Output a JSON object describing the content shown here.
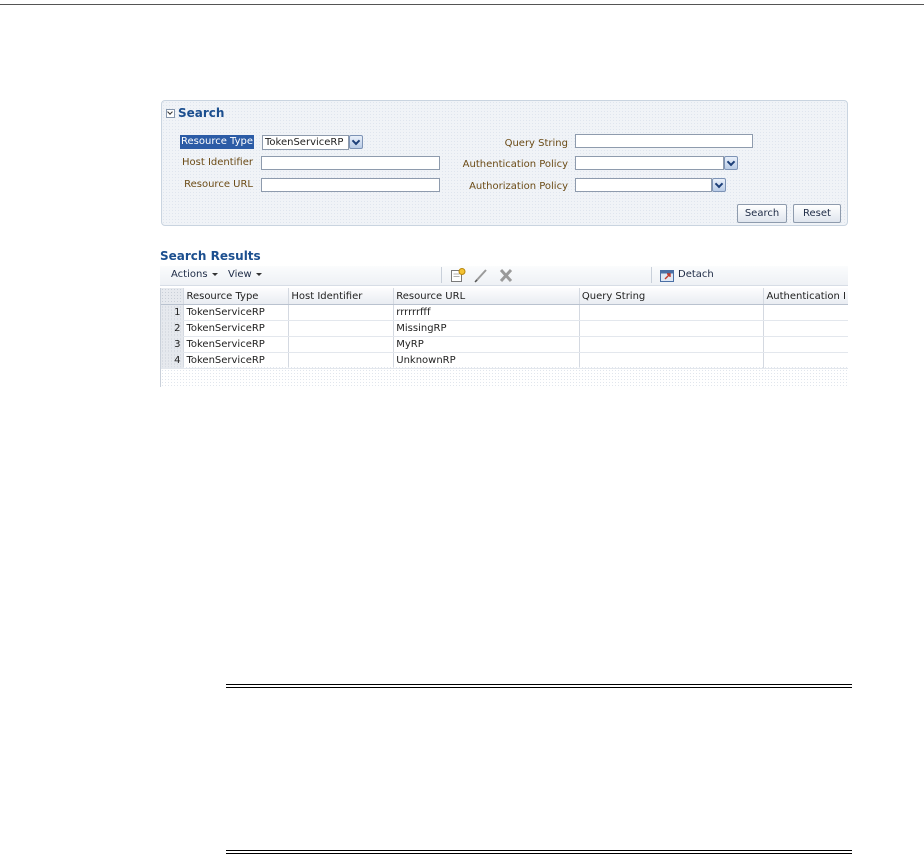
{
  "search": {
    "title": "Search",
    "labels": {
      "resource_type": "Resource Type",
      "host_identifier": "Host Identifier",
      "resource_url": "Resource URL",
      "query_string": "Query String",
      "authentication_policy": "Authentication Policy",
      "authorization_policy": "Authorization Policy"
    },
    "values": {
      "resource_type": "TokenServiceRP",
      "host_identifier": "",
      "resource_url": "",
      "query_string": "",
      "authentication_policy": "",
      "authorization_policy": ""
    },
    "buttons": {
      "search": "Search",
      "reset": "Reset"
    }
  },
  "results": {
    "title": "Search Results",
    "toolbar": {
      "actions": "Actions",
      "view": "View",
      "detach": "Detach",
      "icons": [
        "new-icon",
        "edit-icon",
        "delete-icon",
        "detach-icon"
      ]
    },
    "columns": [
      "Resource Type",
      "Host Identifier",
      "Resource URL",
      "Query String",
      "Authentication I"
    ],
    "rows": [
      {
        "num": "1",
        "resource_type": "TokenServiceRP",
        "host_identifier": "",
        "resource_url": "rrrrrrfff",
        "query_string": "",
        "authentication_policy": ""
      },
      {
        "num": "2",
        "resource_type": "TokenServiceRP",
        "host_identifier": "",
        "resource_url": "MissingRP",
        "query_string": "",
        "authentication_policy": ""
      },
      {
        "num": "3",
        "resource_type": "TokenServiceRP",
        "host_identifier": "",
        "resource_url": "MyRP",
        "query_string": "",
        "authentication_policy": ""
      },
      {
        "num": "4",
        "resource_type": "TokenServiceRP",
        "host_identifier": "",
        "resource_url": "UnknownRP",
        "query_string": "",
        "authentication_policy": ""
      }
    ]
  },
  "colors": {
    "accent": "#1c4f8f",
    "label": "#6b4b16",
    "highlight": "#2c5ca6"
  }
}
